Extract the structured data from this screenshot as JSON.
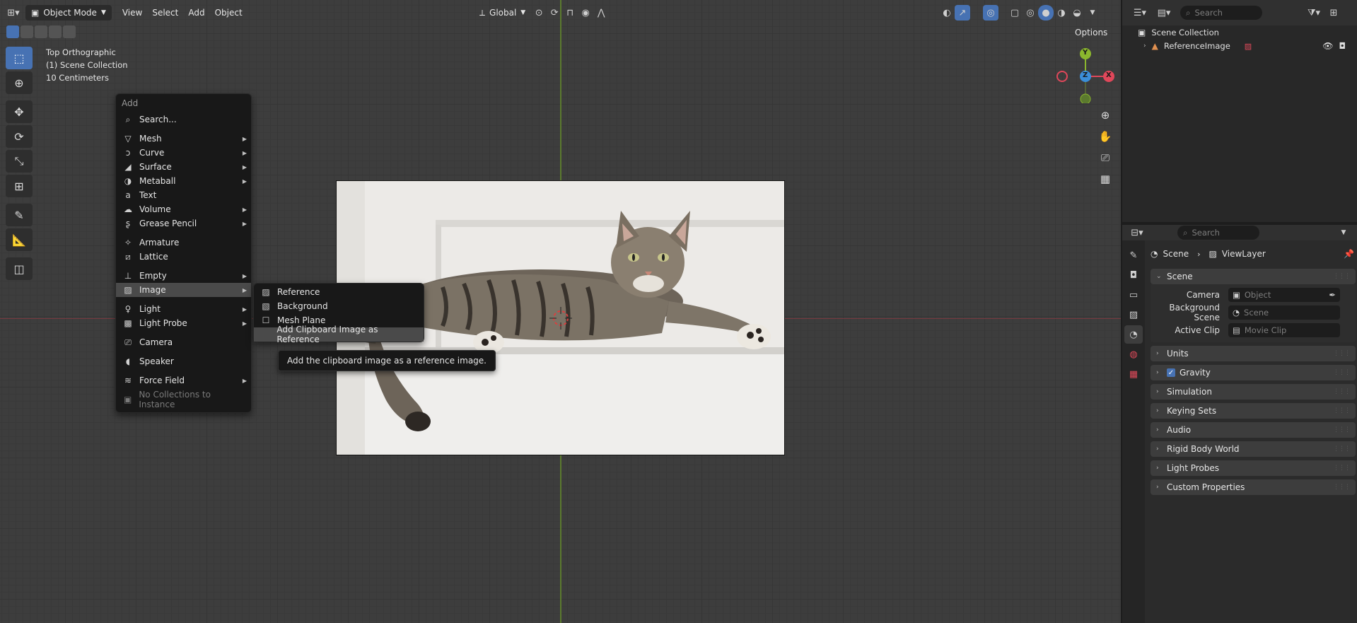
{
  "header": {
    "mode": "Object Mode",
    "menus": [
      "View",
      "Select",
      "Add",
      "Object"
    ],
    "transform_orientation": "Global",
    "options_label": "Options"
  },
  "overlay": {
    "view_name": "Top Orthographic",
    "collection": "(1) Scene Collection",
    "scale": "10 Centimeters"
  },
  "gizmo": {
    "y": "Y",
    "z": "Z",
    "x": "X"
  },
  "add_menu": {
    "title": "Add",
    "search": "Search...",
    "items": [
      {
        "label": "Mesh",
        "icon": "mesh-icon",
        "submenu": true
      },
      {
        "label": "Curve",
        "icon": "curve-icon",
        "submenu": true
      },
      {
        "label": "Surface",
        "icon": "surface-icon",
        "submenu": true
      },
      {
        "label": "Metaball",
        "icon": "metaball-icon",
        "submenu": true
      },
      {
        "label": "Text",
        "icon": "text-icon",
        "submenu": false
      },
      {
        "label": "Volume",
        "icon": "volume-icon",
        "submenu": true
      },
      {
        "label": "Grease Pencil",
        "icon": "grease-pencil-icon",
        "submenu": true
      },
      {
        "label": "Armature",
        "icon": "armature-icon",
        "submenu": false
      },
      {
        "label": "Lattice",
        "icon": "lattice-icon",
        "submenu": false
      },
      {
        "label": "Empty",
        "icon": "empty-icon",
        "submenu": true
      },
      {
        "label": "Image",
        "icon": "image-icon",
        "submenu": true
      },
      {
        "label": "Light",
        "icon": "light-icon",
        "submenu": true
      },
      {
        "label": "Light Probe",
        "icon": "light-probe-icon",
        "submenu": true
      },
      {
        "label": "Camera",
        "icon": "camera-icon",
        "submenu": false
      },
      {
        "label": "Speaker",
        "icon": "speaker-icon",
        "submenu": false
      },
      {
        "label": "Force Field",
        "icon": "force-field-icon",
        "submenu": true
      },
      {
        "label": "No Collections to Instance",
        "icon": "collection-icon",
        "submenu": false
      }
    ]
  },
  "image_submenu": {
    "items": [
      "Reference",
      "Background",
      "Mesh Plane",
      "Add Clipboard Image as Reference"
    ]
  },
  "tooltip": "Add the clipboard image as a reference image.",
  "outliner": {
    "search_placeholder": "Search",
    "root": "Scene Collection",
    "item": "ReferenceImage"
  },
  "properties": {
    "search_placeholder": "Search",
    "breadcrumb": [
      "Scene",
      "ViewLayer"
    ],
    "scene_panel": "Scene",
    "fields": [
      {
        "label": "Camera",
        "value": "Object"
      },
      {
        "label": "Background Scene",
        "value": "Scene"
      },
      {
        "label": "Active Clip",
        "value": "Movie Clip"
      }
    ],
    "panels": [
      "Units",
      "Gravity",
      "Simulation",
      "Keying Sets",
      "Audio",
      "Rigid Body World",
      "Light Probes",
      "Custom Properties"
    ]
  },
  "colors": {
    "accent": "#4772b3",
    "axis_x": "#e0475a",
    "axis_y": "#8bb72e",
    "axis_z": "#3b8ed8"
  }
}
